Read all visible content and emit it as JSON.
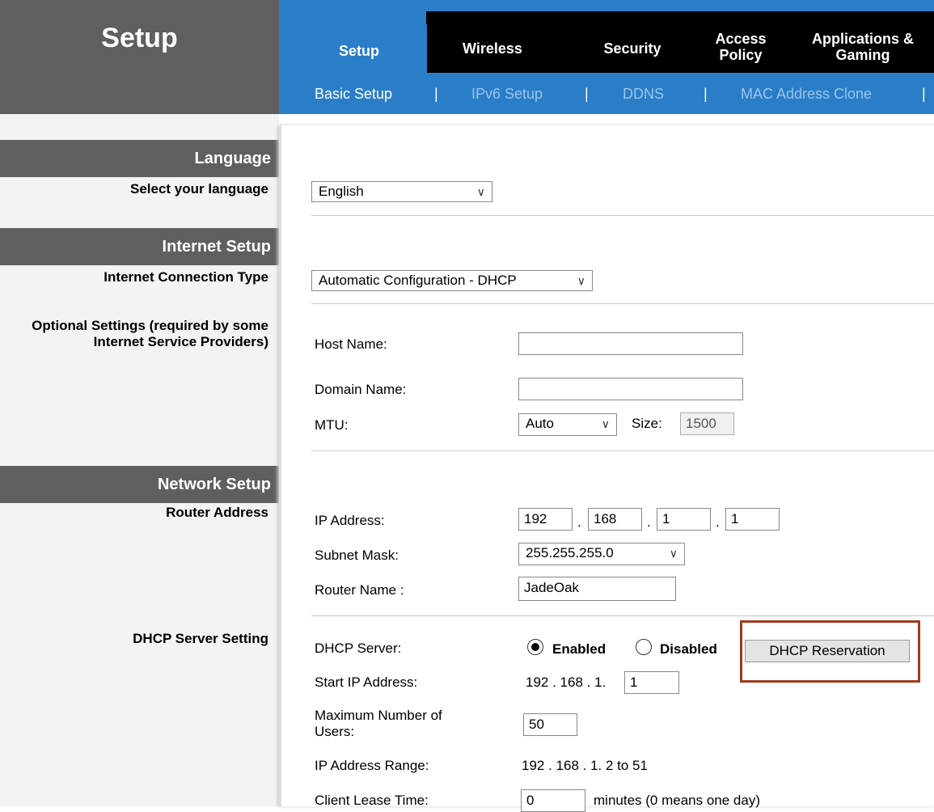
{
  "header": {
    "page_title": "Setup",
    "tabs": [
      {
        "label": "Setup"
      },
      {
        "label": "Wireless"
      },
      {
        "label": "Security"
      },
      {
        "label": "Access Policy"
      },
      {
        "label": "Applications & Gaming"
      }
    ],
    "subnav": [
      {
        "label": "Basic Setup"
      },
      {
        "label": "IPv6 Setup"
      },
      {
        "label": "DDNS"
      },
      {
        "label": "MAC Address Clone"
      }
    ],
    "separator": "|"
  },
  "sections": {
    "language": "Language",
    "internet_setup": "Internet Setup",
    "network_setup": "Network Setup"
  },
  "labels": {
    "select_language": "Select your language",
    "connection_type": "Internet Connection Type",
    "optional_settings": "Optional Settings (required by some Internet Service Providers)",
    "router_address": "Router Address",
    "dhcp_server_setting": "DHCP Server Setting"
  },
  "language": {
    "value": "English"
  },
  "internet": {
    "connection_type": "Automatic Configuration - DHCP",
    "host_name_label": "Host Name:",
    "host_name": "",
    "domain_name_label": "Domain Name:",
    "domain_name": "",
    "mtu_label": "MTU:",
    "mtu_value": "Auto",
    "size_label": "Size:",
    "size_value": "1500"
  },
  "router": {
    "ip_label": "IP Address:",
    "ip": [
      "192",
      "168",
      "1",
      "1"
    ],
    "dot": ".",
    "subnet_label": "Subnet Mask:",
    "subnet": "255.255.255.0",
    "name_label": "Router Name :",
    "name": "JadeOak"
  },
  "dhcp": {
    "server_label": "DHCP Server:",
    "enabled_label": "Enabled",
    "disabled_label": "Disabled",
    "enabled": true,
    "reservation_button": "DHCP Reservation",
    "start_ip_label": "Start IP Address:",
    "start_ip_prefix": "192 . 168 . 1.",
    "start_ip_last": "1",
    "max_users_label": "Maximum Number of Users:",
    "max_users": "50",
    "range_label": "IP Address Range:",
    "range_value": "192 . 168 . 1. 2 to 51",
    "lease_label": "Client Lease Time:",
    "lease_value": "0",
    "lease_note": "minutes (0 means one day)"
  }
}
